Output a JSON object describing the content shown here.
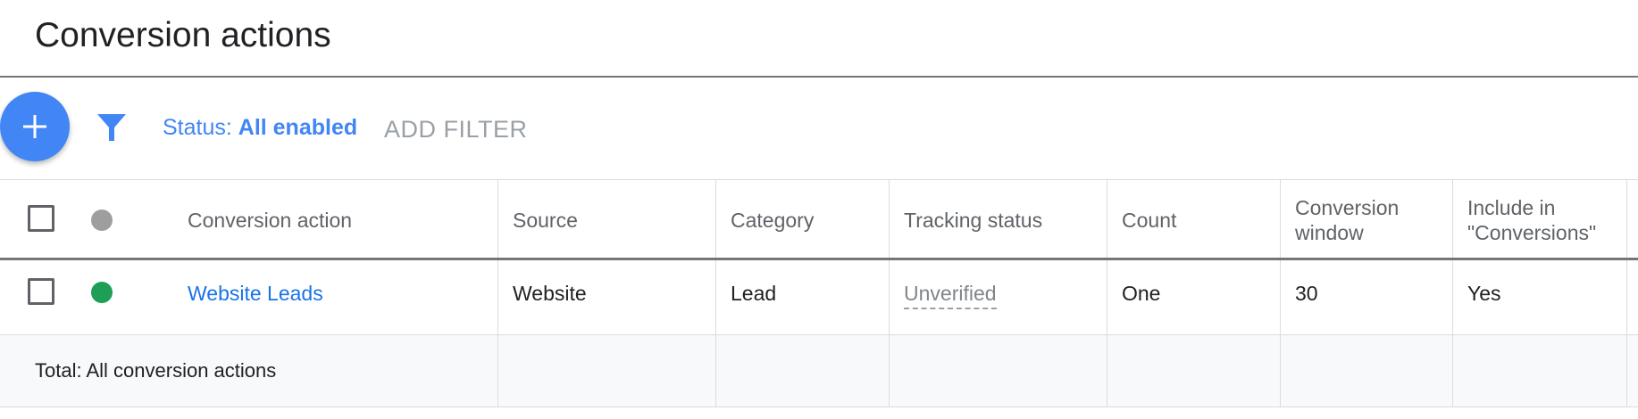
{
  "page": {
    "title": "Conversion actions"
  },
  "toolbar": {
    "status_prefix": "Status: ",
    "status_value": "All enabled",
    "add_filter": "ADD FILTER"
  },
  "table": {
    "headers": {
      "conversion_action": "Conversion action",
      "source": "Source",
      "category": "Category",
      "tracking_status": "Tracking status",
      "count": "Count",
      "conversion_window_1": "Conversion",
      "conversion_window_2": "window",
      "include_1": "Include in",
      "include_2": "\"Conversions\""
    },
    "rows": [
      {
        "conversion_action": "Website Leads",
        "source": "Website",
        "category": "Lead",
        "tracking_status": "Unverified",
        "count": "One",
        "conversion_window": "30",
        "include": "Yes",
        "status_color": "#1e9e57"
      }
    ],
    "total_label": "Total: All conversion actions"
  },
  "colors": {
    "accent": "#4285f4",
    "link": "#1a73e8",
    "enabled": "#1e9e57",
    "all_status": "#9e9e9e"
  },
  "icons": {
    "fab": "plus-icon",
    "filter": "filter-funnel-icon"
  }
}
